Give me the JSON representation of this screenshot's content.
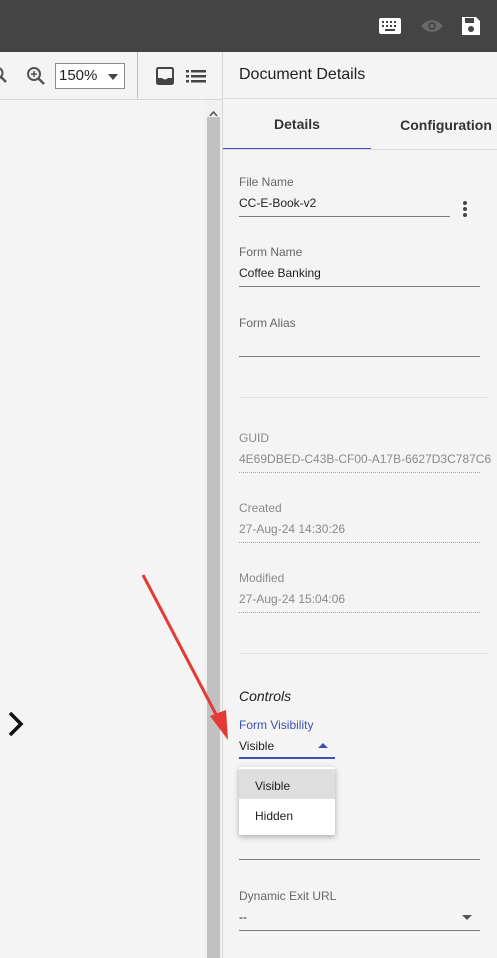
{
  "icons": {
    "keyboard": "keyboard-icon",
    "preview": "eye-icon",
    "save": "save-icon",
    "zoom_out": "zoom-out-icon",
    "zoom_in": "zoom-in-icon",
    "inbox": "inbox-icon",
    "list": "list-icon",
    "next_page": "chevron-right-icon",
    "more": "more-vert-icon"
  },
  "toolbar": {
    "zoom_value": "150%"
  },
  "panel": {
    "title": "Document Details",
    "tabs": [
      {
        "label": "Details",
        "active": true
      },
      {
        "label": "Configuration",
        "active": false
      }
    ]
  },
  "details": {
    "file_name_label": "File Name",
    "file_name_value": "CC-E-Book-v2",
    "form_name_label": "Form Name",
    "form_name_value": "Coffee Banking",
    "form_alias_label": "Form Alias",
    "form_alias_value": "",
    "guid_label": "GUID",
    "guid_value": "4E69DBED-C43B-CF00-A17B-6627D3C787C6",
    "created_label": "Created",
    "created_value": "27-Aug-24 14:30:26",
    "modified_label": "Modified",
    "modified_value": "27-Aug-24 15:04:06"
  },
  "controls": {
    "heading": "Controls",
    "visibility_label": "Form Visibility",
    "visibility_value": "Visible",
    "visibility_options": [
      "Visible",
      "Hidden"
    ],
    "exit_url_label": "Dynamic Exit URL",
    "exit_url_value": "--"
  },
  "colors": {
    "topbar": "#444444",
    "accent": "#3f51b5",
    "annotation_arrow": "#e53935"
  }
}
